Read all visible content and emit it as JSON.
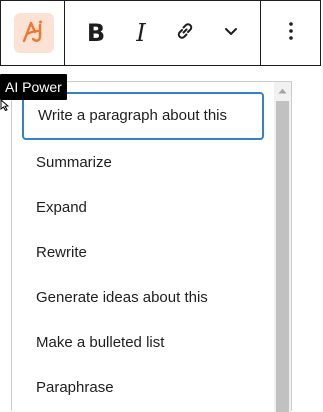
{
  "toolbar": {
    "ai_button_icon": "ai-power-logo-icon",
    "bold_label": "B",
    "italic_label": "I",
    "link_icon": "link-icon",
    "more_icon": "chevron-down-icon",
    "options_icon": "kebab-menu-icon",
    "accent_color": "#f0762d",
    "ai_bg_color": "#fbe2d4"
  },
  "tooltip": {
    "text": "AI Power"
  },
  "menu": {
    "focus_color": "#3582c4",
    "items": [
      {
        "label": "Write a paragraph about this"
      },
      {
        "label": "Summarize"
      },
      {
        "label": "Expand"
      },
      {
        "label": "Rewrite"
      },
      {
        "label": "Generate ideas about this"
      },
      {
        "label": "Make a bulleted list"
      },
      {
        "label": "Paraphrase"
      }
    ]
  }
}
